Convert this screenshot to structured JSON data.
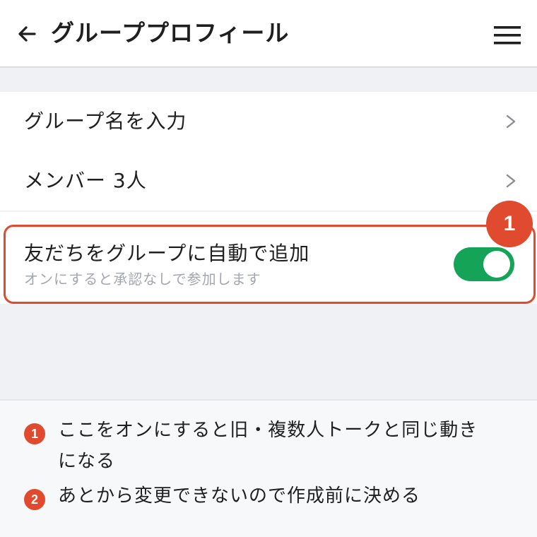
{
  "header": {
    "title": "グループプロフィール",
    "back_icon": "arrow-left-icon",
    "menu_icon": "hamburger-menu-icon"
  },
  "rows": [
    {
      "label": "グループ名を入力",
      "icon": "chevron-right-icon"
    },
    {
      "label": "メンバー 3人",
      "icon": "chevron-right-icon"
    }
  ],
  "auto_add": {
    "title": "友だちをグループに自動で追加",
    "subtitle": "オンにすると承認なしで参加します",
    "enabled": true,
    "toggle_color": "#15a457"
  },
  "callout": {
    "number": "1",
    "color": "#e04a2f"
  },
  "notes": [
    {
      "number": "1",
      "line1": "ここをオンにすると旧・複数人トークと同じ動き",
      "line2": "になる"
    },
    {
      "number": "2",
      "text": "あとから変更できないので作成前に決める"
    }
  ]
}
